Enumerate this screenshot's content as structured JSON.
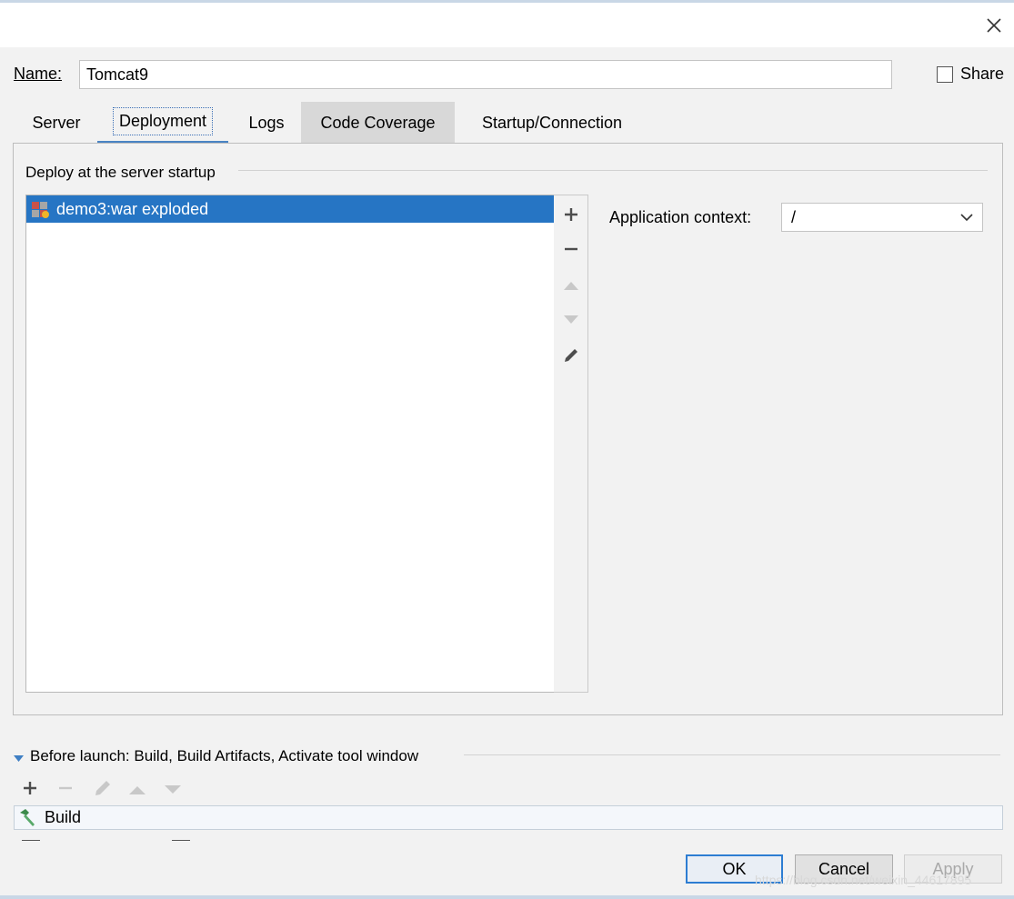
{
  "window": {
    "close_icon": "close-icon"
  },
  "name_field": {
    "label": "Name:",
    "value": "Tomcat9"
  },
  "share": {
    "label": "Share",
    "checked": false
  },
  "tabs": [
    {
      "label": "Server",
      "state": "normal"
    },
    {
      "label": "Deployment",
      "state": "selected"
    },
    {
      "label": "Logs",
      "state": "normal"
    },
    {
      "label": "Code Coverage",
      "state": "hover"
    },
    {
      "label": "Startup/Connection",
      "state": "normal"
    }
  ],
  "deploy": {
    "section_title": "Deploy at the server startup",
    "items": [
      {
        "label": "demo3:war exploded",
        "icon": "artifact-icon",
        "selected": true
      }
    ],
    "toolbar": [
      "add-icon",
      "remove-icon",
      "move-up-icon",
      "move-down-icon",
      "edit-icon"
    ]
  },
  "app_context": {
    "label": "Application context:",
    "value": "/"
  },
  "before_launch": {
    "title": "Before launch: Build, Build Artifacts, Activate tool window",
    "toolbar": [
      "add-icon",
      "remove-icon",
      "edit-icon",
      "move-up-icon",
      "move-down-icon"
    ],
    "tasks": [
      {
        "label": "Build",
        "icon": "hammer-icon"
      }
    ]
  },
  "buttons": {
    "ok": "OK",
    "cancel": "Cancel",
    "apply": "Apply"
  },
  "watermark": "https://blog.csdn.net/weixin_44617895",
  "colors": {
    "selection": "#2675c4",
    "tab_underline": "#4a84c4",
    "hover_tab": "#d8d8d8"
  }
}
